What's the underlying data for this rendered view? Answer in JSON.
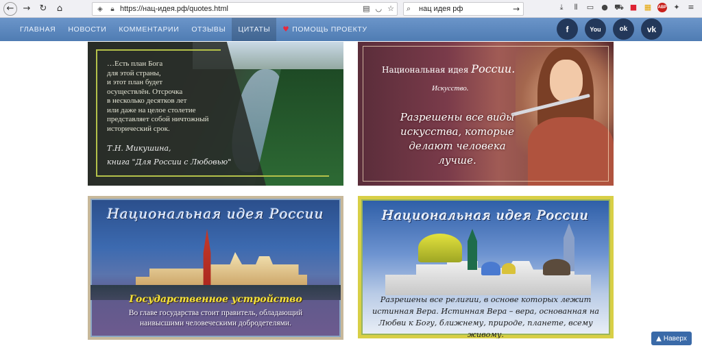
{
  "browser": {
    "url": "https://нац-идея.рф/quotes.html",
    "search_value": "нац идея рф",
    "icons": [
      "back-icon",
      "forward-icon",
      "reload-icon",
      "home-icon",
      "shield-icon",
      "lock-icon",
      "reader-icon",
      "pocket-icon",
      "bookmark-star-icon",
      "search-icon",
      "go-arrow-icon",
      "download-icon",
      "library-icon",
      "sidebar-icon",
      "account-icon",
      "cart-icon",
      "flag-icon",
      "wallet-icon",
      "abp-icon",
      "extensions-icon",
      "menu-icon"
    ],
    "abp_label": "ABP"
  },
  "nav": {
    "items": [
      {
        "label": "ГЛАВНАЯ"
      },
      {
        "label": "НОВОСТИ"
      },
      {
        "label": "КОММЕНТАРИИ"
      },
      {
        "label": "ОТЗЫВЫ"
      },
      {
        "label": "ЦИТАТЫ",
        "active": true
      },
      {
        "label": "ПОМОЩЬ ПРОЕКТУ",
        "icon": "heart-icon"
      }
    ],
    "social": [
      {
        "name": "facebook",
        "glyph": "f"
      },
      {
        "name": "youtube",
        "glyph": "You"
      },
      {
        "name": "odnoklassniki",
        "glyph": "ok"
      },
      {
        "name": "vkontakte",
        "glyph": "vk"
      }
    ]
  },
  "cards": {
    "quote1": {
      "text_lines": [
        "…Есть план Бога",
        "для этой страны,",
        "и этот план будет",
        "осуществлён. Отсрочка",
        "в несколько десятков лет",
        "или даже на целое столетие",
        "представляет собой ничтожный",
        "исторический срок."
      ],
      "author": "Т.Н. Микушина,",
      "source": "книга \"Для России с Любовью\""
    },
    "quote2": {
      "heading": "Национальная идея",
      "heading_big": "России.",
      "sub": "Искусство.",
      "text": "Разрешены все виды искусства, которые делают человека лучше."
    },
    "quote3": {
      "title": "Национальная идея России",
      "sub": "Государственное устройство",
      "text": "Во главе государства стоит правитель, обладающий наивысшими человеческими добродетелями."
    },
    "quote4": {
      "title": "Национальная идея России",
      "text": "Разрешены все религии, в основе которых лежит истинная Вера. Истинная Вера – вера, основанная на Любви к Богу, ближнему, природе, планете, всему живому."
    }
  },
  "to_top": {
    "label": "Наверх"
  }
}
